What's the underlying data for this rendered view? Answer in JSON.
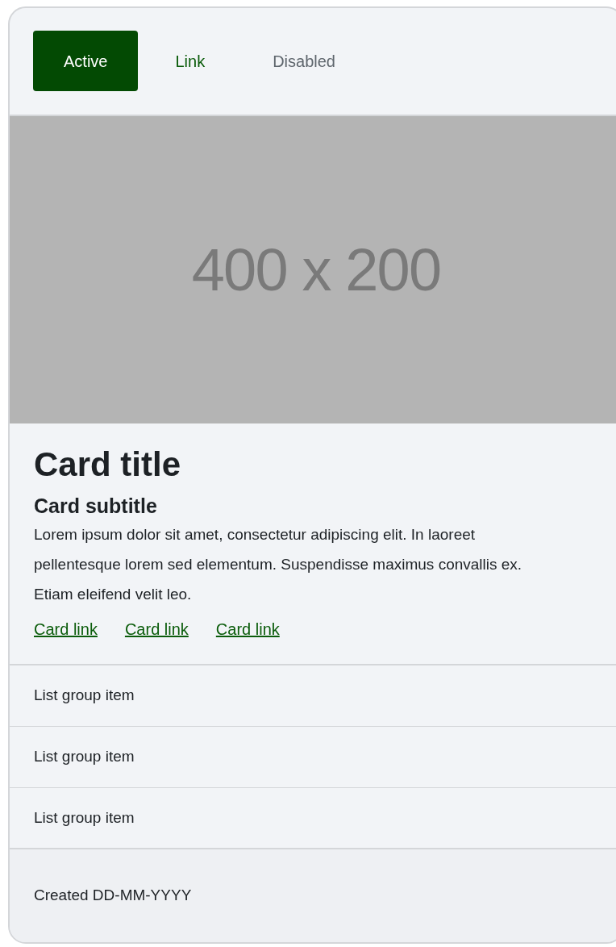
{
  "nav": [
    {
      "label": "Active",
      "selected": true,
      "disabled": false
    },
    {
      "label": "Link",
      "selected": false,
      "disabled": false
    },
    {
      "label": "Disabled",
      "selected": false,
      "disabled": true
    }
  ],
  "image": {
    "label": "400 x 200"
  },
  "card": {
    "title": "Card title",
    "subtitle": "Card subtitle",
    "text": "Lorem ipsum dolor sit amet, consectetur adipiscing elit. In laoreet pellentesque lorem sed elementum. Suspendisse maximus convallis ex. Etiam eleifend velit leo.",
    "links": [
      "Card link",
      "Card link",
      "Card link"
    ]
  },
  "list_group": [
    "List group item",
    "List group item",
    "List group item"
  ],
  "footer": "Created DD-MM-YYYY"
}
